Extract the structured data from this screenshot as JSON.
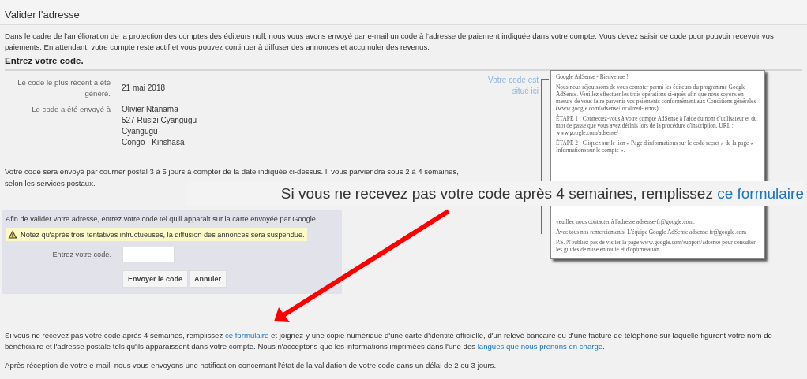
{
  "page": {
    "title": "Valider l'adresse",
    "intro": "Dans le cadre de l'amélioration de la protection des comptes des éditeurs null, nous vous avons envoyé par e-mail un code à l'adresse de paiement indiquée dans votre compte. Vous devez saisir ce code pour pouvoir recevoir vos paiements. En attendant, votre compte reste actif et vous pouvez continuer à diffuser des annonces et accumuler des revenus.",
    "heading": "Entrez votre code."
  },
  "details": [
    {
      "label": "Le code le plus récent a été généré.",
      "lines": [
        "21 mai 2018"
      ]
    },
    {
      "label": "Le code a été envoyé à",
      "lines": [
        "Olivier Ntanama",
        "527 Rusizi Cyangugu",
        "Cyangugu",
        "Congo - Kinshasa"
      ]
    }
  ],
  "postal_note": "Votre code sera envoyé par courrier postal 3 à 5 jours à compter de la date indiquée ci-dessus. Il vous parviendra sous 2 à 4 semaines, selon les services postaux.",
  "letter": {
    "link": "Votre code est situé ici",
    "top": [
      "Google AdSense - Bienvenue !",
      "Nous nous réjouissons de vous compter parmi les éditeurs du programme Google AdSense. Veuillez effectuer les trois opérations ci-après afin que nous soyons en mesure de vous faire parvenir vos paiements conformément aux Conditions générales (www.google.com/adsense/localized-terms).",
      "ÉTAPE 1 : Connectez-vous à votre compte AdSense à l'aide du nom d'utilisateur et du mot de passe que vous avez définis lors de la procédure d'inscription. URL : www.google.com/adsense/",
      "ÉTAPE 2 : Cliquez sur le lien « Page d'informations sur le code secret » de la page « Informations sur le compte »."
    ],
    "bottom": [
      "veuillez nous contacter à l'adresse adsense-fr@google.com.",
      "Avec tous nos remerciements, L'équipe Google AdSense adsense-fr@google.com",
      "P.S. N'oubliez pas de visiter la page www.google.com/support/adsense pour consulter les guides de mise en route et d'optimisation."
    ]
  },
  "form": {
    "instruction": "Afin de valider votre adresse, entrez votre code tel qu'il apparaît sur la carte envoyée par Google.",
    "warning": "Notez qu'après trois tentatives infructueuses, la diffusion des annonces sera suspendue.",
    "field_label": "Entrez votre code.",
    "buttons": [
      "Envoyer le code",
      "Annuler"
    ]
  },
  "banner": [
    {
      "kind": "text",
      "text": "Si vous ne recevez pas votre code après 4 semaines, remplissez "
    },
    {
      "kind": "link",
      "text": "ce formulaire"
    }
  ],
  "footer": [
    [
      {
        "kind": "text",
        "text": "Si vous ne recevez pas votre code après 4 semaines, remplissez "
      },
      {
        "kind": "link",
        "text": "ce formulaire"
      },
      {
        "kind": "text",
        "text": " et joignez-y une copie numérique d'une carte d'identité officielle, d'un relevé bancaire ou d'une facture de téléphone sur laquelle figurent votre nom de bénéficiaire et l'adresse postale tels qu'ils apparaissent dans votre compte. Nous n'acceptons que les informations imprimées dans l'une des "
      },
      {
        "kind": "link",
        "text": "langues que nous prenons en charge"
      },
      {
        "kind": "text",
        "text": "."
      }
    ],
    [
      {
        "kind": "text",
        "text": "Après réception de votre e-mail, nous vous envoyons une notification concernant l'état de la validation de votre code dans un délai de 2 ou 3 jours."
      }
    ]
  ]
}
